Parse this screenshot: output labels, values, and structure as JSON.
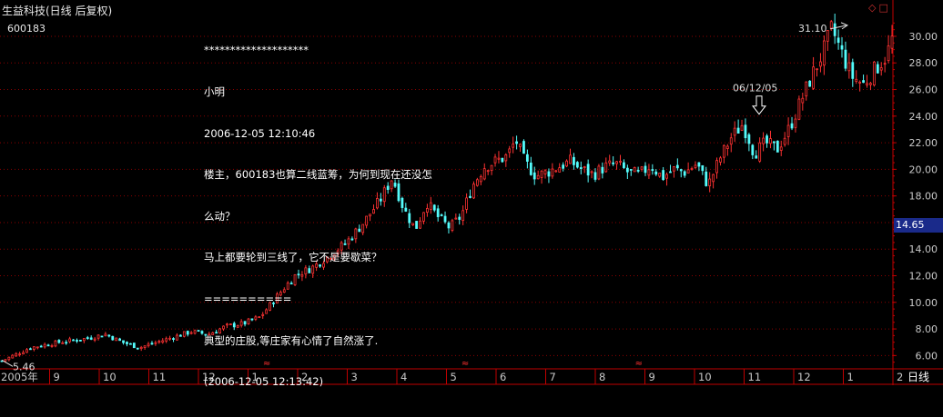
{
  "header": {
    "title": "生益科技(日线 后复权)",
    "stock_code": "600183",
    "icons": [
      "diamond-icon",
      "square-icon"
    ]
  },
  "note": {
    "lines": [
      "********************",
      "小明",
      "2006-12-05 12:10:46",
      "楼主，600183也算二线蓝筹，为何到现在还没怎",
      "么动？",
      "马上都要轮到三线了，它不是要歇菜？",
      "==========",
      "典型的庄股,等庄家有心情了自然涨了.",
      "(2006-12-05 12:13:42)"
    ]
  },
  "current_price": "14.65",
  "period_label": "日线",
  "colors": {
    "up": "#ff3232",
    "down": "#54fcfc",
    "grid": "#8b0000",
    "axis": "#c00000",
    "text": "#c8c8c8",
    "price_tag_bg": "#1a2a8a"
  },
  "chart_data": {
    "type": "candlestick",
    "title": "生益科技(日线 后复权)",
    "ylim": [
      5,
      31.5
    ],
    "yticks": [
      "6.00",
      "8.00",
      "10.00",
      "12.00",
      "14.00",
      "16.00",
      "18.00",
      "20.00",
      "22.00",
      "24.00",
      "26.00",
      "28.00",
      "30.00"
    ],
    "xticks": [
      "2005年",
      "9",
      "10",
      "11",
      "12",
      "1",
      "2",
      "3",
      "4",
      "5",
      "6",
      "7",
      "8",
      "9",
      "10",
      "11",
      "12",
      "1",
      "2"
    ],
    "xtick_count": 19,
    "low_annotation": {
      "label": "5.46",
      "value": 5.46
    },
    "high_annotation": {
      "label": "31.10",
      "value": 31.1
    },
    "date_annotation": {
      "label": "06/12/05",
      "value": 23.8
    },
    "markers": [
      "≈",
      "≈",
      "≈"
    ],
    "close_path": [
      [
        0,
        5.6
      ],
      [
        5,
        6.6
      ],
      [
        10,
        7.0
      ],
      [
        15,
        7.3
      ],
      [
        18,
        7.6
      ],
      [
        21,
        7.0
      ],
      [
        24,
        6.6
      ],
      [
        27,
        7.0
      ],
      [
        30,
        7.4
      ],
      [
        33,
        7.8
      ],
      [
        36,
        7.6
      ],
      [
        39,
        8.2
      ],
      [
        42,
        8.4
      ],
      [
        45,
        8.9
      ],
      [
        48,
        10.5
      ],
      [
        51,
        12.0
      ],
      [
        54,
        12.6
      ],
      [
        57,
        13.5
      ],
      [
        60,
        14.5
      ],
      [
        63,
        16.0
      ],
      [
        66,
        17.8
      ],
      [
        68,
        19.4
      ],
      [
        70,
        17.0
      ],
      [
        72,
        15.5
      ],
      [
        74,
        17.5
      ],
      [
        76,
        16.4
      ],
      [
        78,
        15.6
      ],
      [
        80,
        16.5
      ],
      [
        82,
        18.8
      ],
      [
        84,
        20.2
      ],
      [
        86,
        20.6
      ],
      [
        88,
        21.0
      ],
      [
        89.5,
        22.2
      ],
      [
        91,
        20.6
      ],
      [
        93,
        19.5
      ],
      [
        95,
        19.8
      ],
      [
        97,
        20.2
      ],
      [
        99,
        20.6
      ],
      [
        101,
        20.0
      ],
      [
        103,
        19.6
      ],
      [
        105,
        20.2
      ],
      [
        107,
        20.4
      ],
      [
        109,
        19.8
      ],
      [
        111,
        19.6
      ],
      [
        113,
        20.3
      ],
      [
        115,
        19.4
      ],
      [
        117,
        20.0
      ],
      [
        119,
        19.8
      ],
      [
        121,
        20.4
      ],
      [
        123,
        18.8
      ],
      [
        125,
        20.8
      ],
      [
        127,
        22.4
      ],
      [
        129,
        23.4
      ],
      [
        130,
        22.4
      ],
      [
        131,
        21.2
      ],
      [
        133,
        22.0
      ],
      [
        135,
        21.5
      ],
      [
        137,
        23.0
      ],
      [
        139,
        25.0
      ],
      [
        141,
        27.0
      ],
      [
        143,
        28.8
      ],
      [
        144.5,
        30.6
      ],
      [
        146,
        29.0
      ],
      [
        148,
        27.0
      ],
      [
        150,
        26.4
      ],
      [
        152,
        27.5
      ],
      [
        154,
        28.5
      ],
      [
        155,
        29.8
      ]
    ]
  }
}
